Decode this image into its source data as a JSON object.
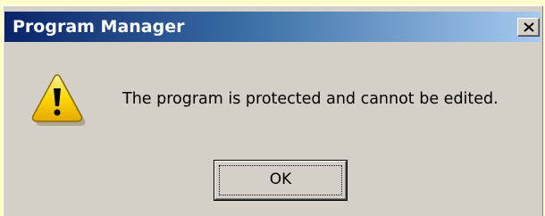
{
  "window": {
    "title": "Program Manager",
    "close_icon": "close-x-icon"
  },
  "dialog": {
    "icon": "warning-icon",
    "message": "The program is protected and cannot be edited.",
    "ok_label": "OK"
  },
  "colors": {
    "titlebar_start": "#0a246a",
    "titlebar_end": "#a6caf0",
    "dialog_face": "#d4d0c8",
    "warning_yellow": "#ffd700",
    "background": "#ffffcc"
  }
}
